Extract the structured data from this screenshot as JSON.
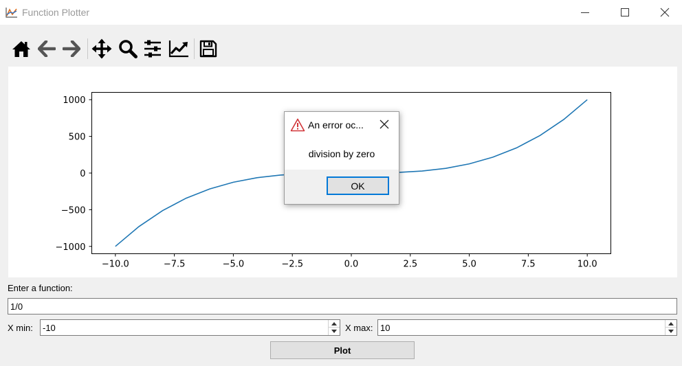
{
  "window": {
    "title": "Function Plotter",
    "controls": {
      "minimize_icon": "minimize-icon",
      "maximize_icon": "maximize-icon",
      "close_icon": "close-icon"
    }
  },
  "toolbar": {
    "tools": [
      {
        "name": "home",
        "icon": "home-icon"
      },
      {
        "name": "back",
        "icon": "arrow-left-icon"
      },
      {
        "name": "forward",
        "icon": "arrow-right-icon"
      },
      {
        "name": "pan",
        "icon": "move-icon"
      },
      {
        "name": "zoom",
        "icon": "zoom-icon"
      },
      {
        "name": "configure-subplots",
        "icon": "sliders-icon"
      },
      {
        "name": "edit-axis",
        "icon": "line-chart-icon"
      },
      {
        "name": "save",
        "icon": "save-icon"
      }
    ]
  },
  "chart_data": {
    "type": "line",
    "title": "",
    "xlabel": "",
    "ylabel": "",
    "xlim": [
      -11.0,
      11.0
    ],
    "ylim": [
      -1100,
      1100
    ],
    "xticks": [
      -10.0,
      -7.5,
      -5.0,
      -2.5,
      0.0,
      2.5,
      5.0,
      7.5,
      10.0
    ],
    "xtick_labels": [
      "−10.0",
      "−7.5",
      "−5.0",
      "−2.5",
      "0.0",
      "2.5",
      "5.0",
      "7.5",
      "10.0"
    ],
    "yticks": [
      1000,
      500,
      0,
      -500,
      -1000
    ],
    "ytick_labels": [
      "1000",
      "500",
      "0",
      "−500",
      "−1000"
    ],
    "line_color": "#1f77b4",
    "grid": false,
    "series": [
      {
        "x": [
          -10,
          -9,
          -8,
          -7,
          -6,
          -5,
          -4,
          -3,
          -2,
          -1,
          0,
          1,
          2,
          3,
          4,
          5,
          6,
          7,
          8,
          9,
          10
        ],
        "values": [
          -1000,
          -729,
          -512,
          -343,
          -216,
          -125,
          -64,
          -27,
          -8,
          -1,
          0,
          1,
          8,
          27,
          64,
          125,
          216,
          343,
          512,
          729,
          1000
        ]
      }
    ]
  },
  "dialog": {
    "title": "An error oc...",
    "message": "division by zero",
    "ok_label": "OK",
    "warning_icon": "warning-icon",
    "close_icon": "close-icon"
  },
  "form": {
    "function_label": "Enter a function:",
    "function_value": "1/0",
    "xmin_label": "X min:",
    "xmin_value": "-10",
    "xmax_label": "X max:",
    "xmax_value": "10",
    "plot_label": "Plot"
  }
}
